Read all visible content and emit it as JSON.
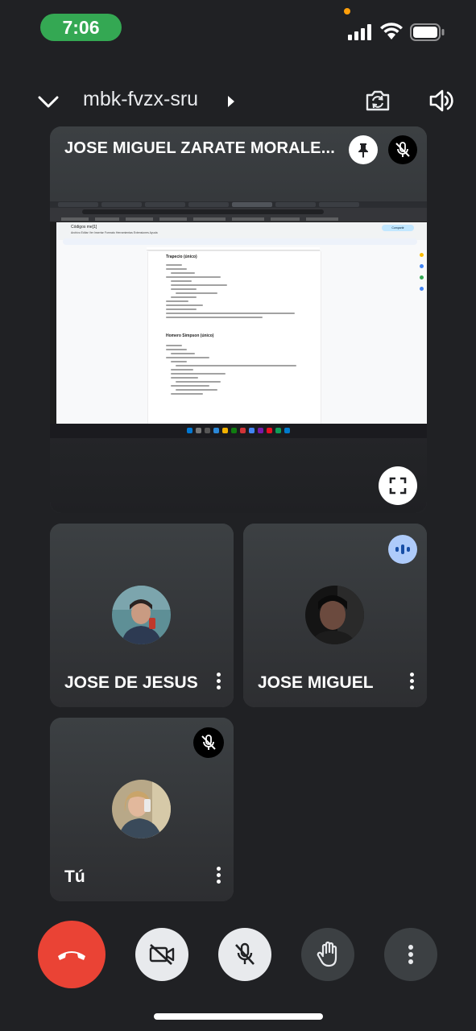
{
  "status_bar": {
    "time": "7:06",
    "icons": [
      "orange-dot-indicator",
      "cellular-signal-icon",
      "wifi-icon",
      "battery-icon"
    ]
  },
  "header": {
    "meeting_code": "mbk-fvzx-sru",
    "icons": [
      "chevron-down-icon",
      "chevron-right-icon",
      "switch-camera-icon",
      "speaker-icon"
    ]
  },
  "presenter": {
    "name": "JOSE MIGUEL ZARATE MORALE...",
    "icons": [
      "pin-icon",
      "mic-off-icon",
      "fullscreen-icon"
    ],
    "shared_screen": {
      "doc_title": "Códigos me[1]",
      "doc_menu": "Archivo  Editar  Ver  Insertar  Formato  Herramientas  Extensiones  Ayuda",
      "share_label": "Compartir",
      "heading_1": "Trapecio (único)",
      "heading_2": "Homero Simpson (único)"
    }
  },
  "participants": [
    {
      "name": "JOSE DE JESUS",
      "speaking": false,
      "muted": false
    },
    {
      "name": "JOSE MIGUEL",
      "speaking": true,
      "muted": false
    },
    {
      "name": "Tú",
      "speaking": false,
      "muted": true
    }
  ],
  "controls": {
    "icons": [
      "end-call-icon",
      "camera-off-icon",
      "mic-off-icon",
      "raise-hand-icon",
      "more-vertical-icon"
    ]
  },
  "colors": {
    "background": "#202124",
    "tile": "#3c4043",
    "end_call": "#ea4335",
    "time_pill": "#34a853",
    "speaking_badge": "#aecbfa"
  }
}
